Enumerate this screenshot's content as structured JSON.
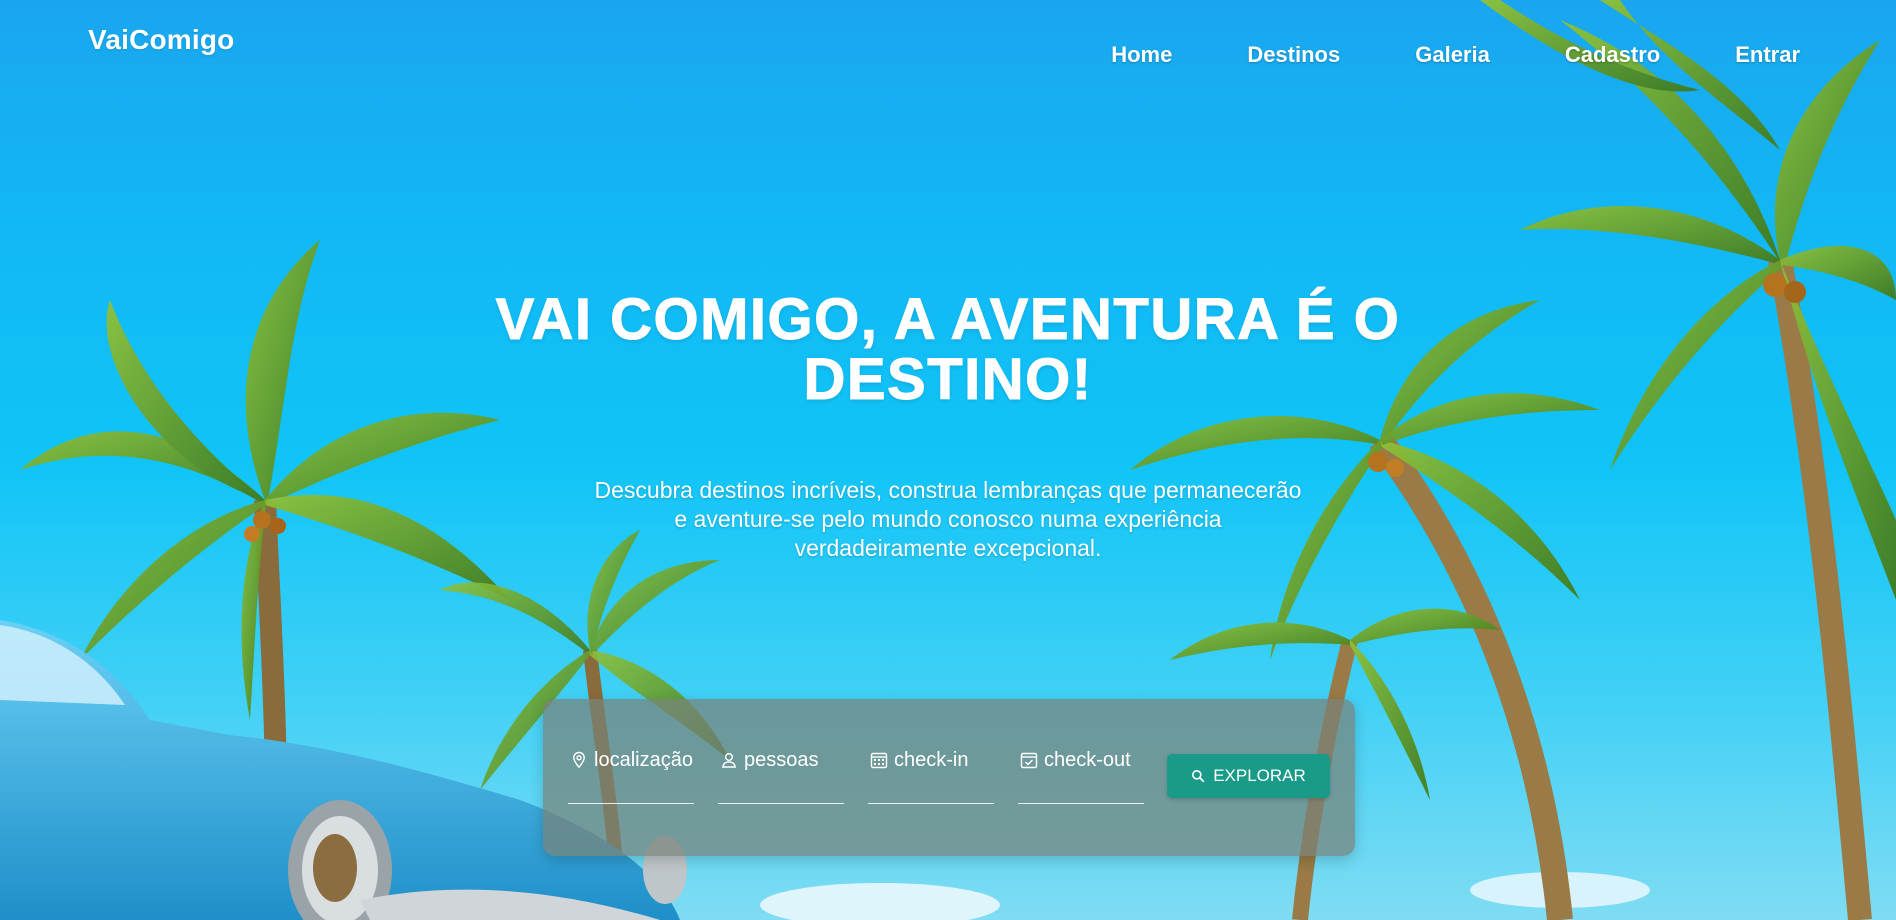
{
  "header": {
    "logo": "VaiComigo",
    "nav": [
      {
        "label": "Home"
      },
      {
        "label": "Destinos"
      },
      {
        "label": "Galeria"
      },
      {
        "label": "Cadastro"
      },
      {
        "label": "Entrar"
      }
    ]
  },
  "hero": {
    "title_line1": "VAI COMIGO, A AVENTURA É O",
    "title_line2": "DESTINO!",
    "subtitle_line1": "Descubra destinos incríveis, construa lembranças que permanecerão",
    "subtitle_line2": "e aventure-se pelo mundo conosco numa experiência",
    "subtitle_line3": "verdadeiramente excepcional."
  },
  "search": {
    "fields": [
      {
        "label": "localização",
        "icon": "location-pin-icon"
      },
      {
        "label": "pessoas",
        "icon": "person-icon"
      },
      {
        "label": "check-in",
        "icon": "calendar-grid-icon"
      },
      {
        "label": "check-out",
        "icon": "calendar-check-icon"
      }
    ],
    "button_label": "EXPLORAR",
    "button_icon": "search-icon"
  },
  "colors": {
    "button": "#1a9a88",
    "sky": "#10c4f7",
    "panel": "rgba(120,130,120,0.72)"
  }
}
